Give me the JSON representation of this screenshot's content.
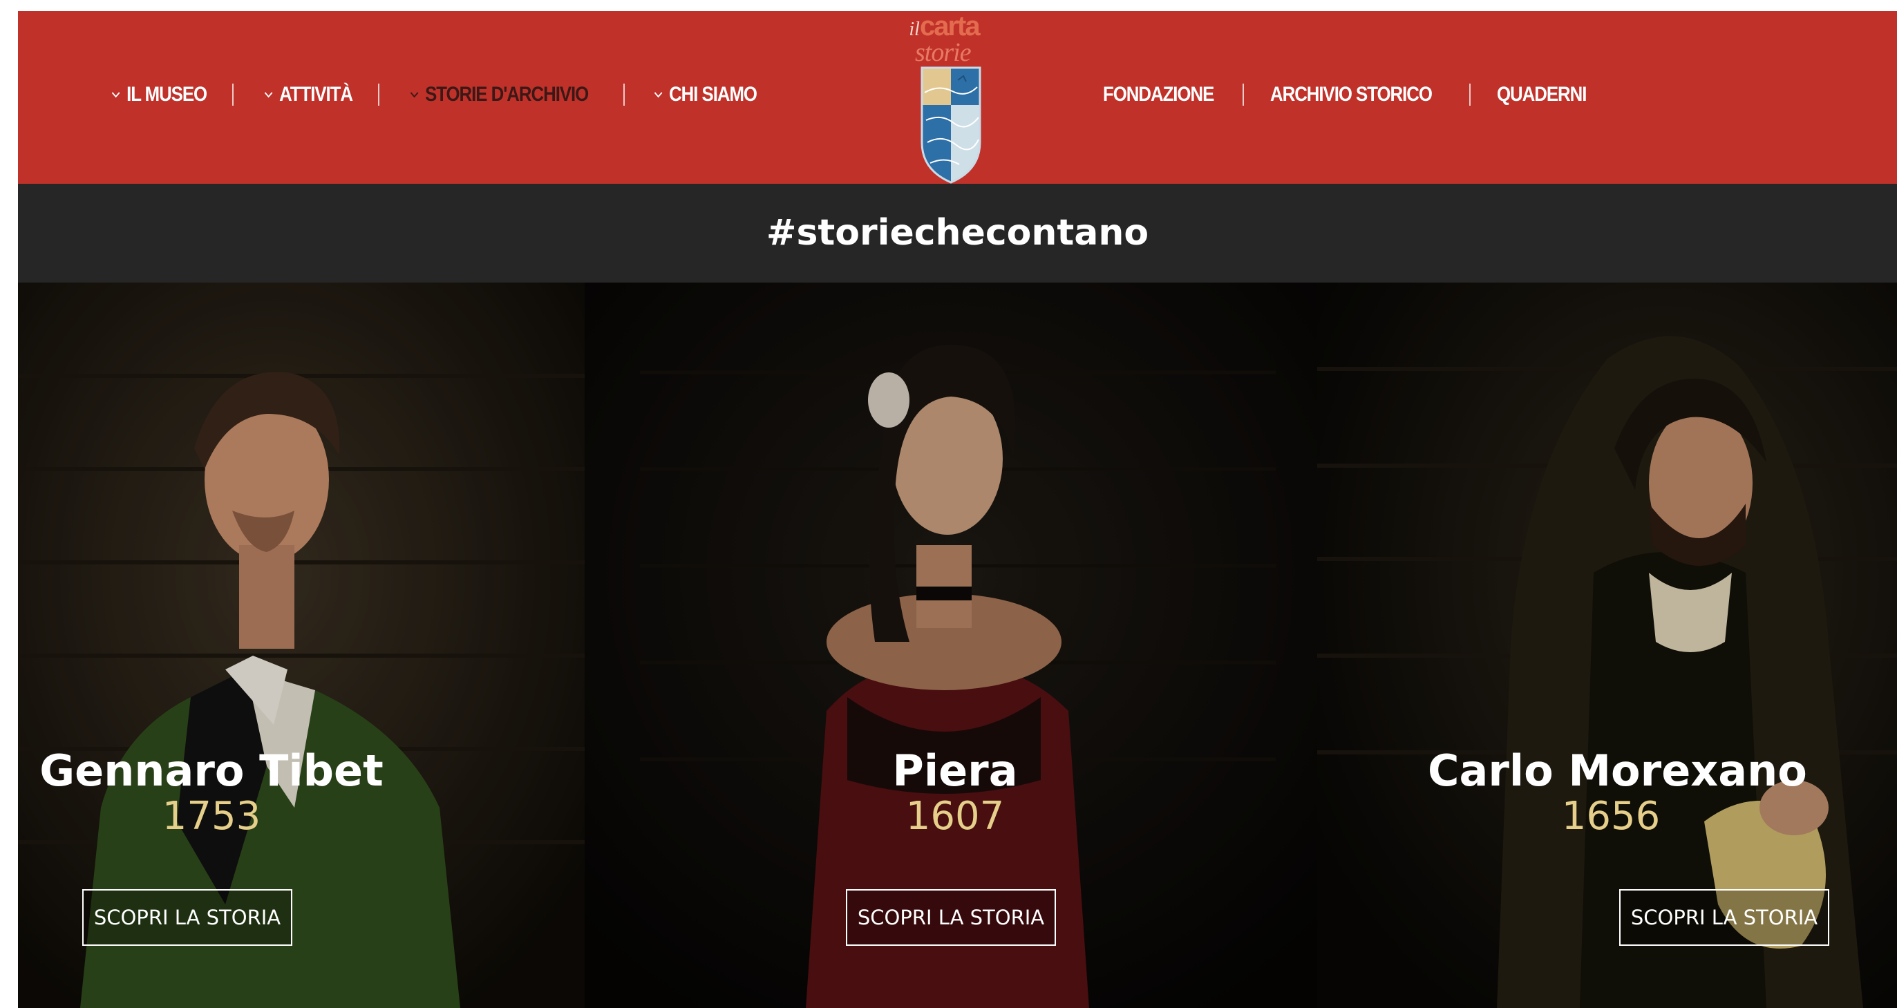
{
  "header": {
    "nav_left": [
      {
        "label": "IL MUSEO",
        "dropdown": true
      },
      {
        "label": "ATTIVITÀ",
        "dropdown": true
      },
      {
        "label": "STORIE D'ARCHIVIO",
        "dropdown": true,
        "active": true
      },
      {
        "label": "CHI SIAMO",
        "dropdown": true
      }
    ],
    "nav_right": [
      {
        "label": "FONDAZIONE"
      },
      {
        "label": "ARCHIVIO STORICO"
      },
      {
        "label": "QUADERNI"
      }
    ],
    "logo": {
      "il": "il",
      "carta": "carta",
      "storie": "storie"
    }
  },
  "banner": {
    "hashtag": "#storiechecontano"
  },
  "stories": [
    {
      "name": "Gennaro Tibet",
      "year": "1753",
      "button": "SCOPRI LA STORIA"
    },
    {
      "name": "Piera",
      "year": "1607",
      "button": "SCOPRI LA STORIA"
    },
    {
      "name": "Carlo Morexano",
      "year": "1656",
      "button": "SCOPRI LA STORIA"
    }
  ],
  "colors": {
    "header_red": "#c0312a",
    "active_nav": "#3b1816",
    "band_dark": "#262626",
    "year_gold": "#e6cf8a"
  }
}
